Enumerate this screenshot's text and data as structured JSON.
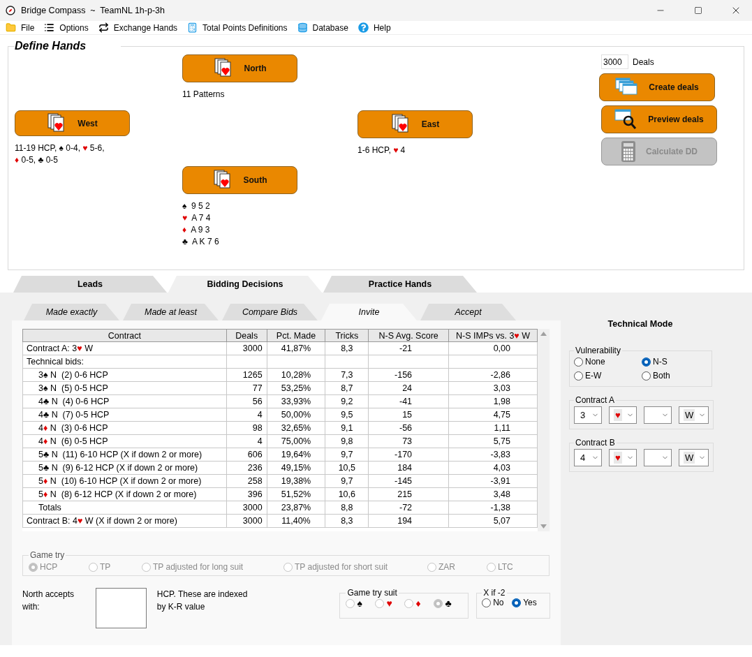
{
  "window": {
    "title": "Bridge Compass  ~  TeamNL 1h-p-3h"
  },
  "menu": [
    {
      "label": "File"
    },
    {
      "label": "Options"
    },
    {
      "label": "Exchange Hands"
    },
    {
      "label": "Total Points Definitions"
    },
    {
      "label": "Database"
    },
    {
      "label": "Help"
    }
  ],
  "define_hands": {
    "title": "Define Hands",
    "hands": [
      {
        "seat": "North",
        "lines": [
          [
            "11 Patterns"
          ]
        ]
      },
      {
        "seat": "West",
        "lines": [
          [
            "11-19 HCP, ",
            {
              "suit": "♠",
              "red": false
            },
            " 0-4, ",
            {
              "suit": "♥",
              "red": true
            },
            " 5-6,"
          ],
          [
            {
              "suit": "♦",
              "red": true
            },
            " 0-5, ",
            {
              "suit": "♣",
              "red": false
            },
            " 0-5"
          ]
        ]
      },
      {
        "seat": "East",
        "lines": [
          [
            "1-6 HCP, ",
            {
              "suit": "♥",
              "red": true
            },
            " 4"
          ]
        ]
      },
      {
        "seat": "South",
        "lines": [
          [
            {
              "suit": "♠",
              "red": false
            },
            "  9 5 2"
          ],
          [
            {
              "suit": "♥",
              "red": true
            },
            "  A 7 4"
          ],
          [
            {
              "suit": "♦",
              "red": true
            },
            "  A 9 3"
          ],
          [
            {
              "suit": "♣",
              "red": false
            },
            "  A K 7 6"
          ]
        ]
      }
    ],
    "deals": {
      "value": "3000",
      "label": "Deals"
    },
    "actions": [
      {
        "label": "Create deals",
        "disabled": false
      },
      {
        "label": "Preview deals",
        "disabled": false
      },
      {
        "label": "Calculate DD",
        "disabled": true
      }
    ]
  },
  "tabs": [
    {
      "label": "Leads",
      "selected": false
    },
    {
      "label": "Bidding Decisions",
      "selected": true
    },
    {
      "label": "Practice Hands",
      "selected": false
    }
  ],
  "subtabs": [
    {
      "label": "Made exactly",
      "selected": false
    },
    {
      "label": "Made at least",
      "selected": false
    },
    {
      "label": "Compare Bids",
      "selected": false
    },
    {
      "label": "Invite",
      "selected": true
    },
    {
      "label": "Accept",
      "selected": false
    }
  ],
  "table": {
    "columns": [
      [
        "Contract"
      ],
      [
        "Deals"
      ],
      [
        "Pct. Made"
      ],
      [
        "Tricks"
      ],
      [
        "N-S Avg. Score"
      ],
      [
        "N-S IMPs vs. 3",
        {
          "suit": "♥",
          "red": true
        },
        " W"
      ]
    ],
    "rows": [
      {
        "contract": [
          "Contract A: 3",
          {
            "suit": "♥",
            "red": true
          },
          " W"
        ],
        "deals": "3000",
        "pct": "41,87%",
        "tricks": "8,3",
        "avg": "-21",
        "imps": "0,00"
      },
      {
        "contract": [
          "Technical bids:"
        ],
        "children": [
          {
            "contract": [
              "3",
              {
                "suit": "♠",
                "red": false
              },
              " N  (2) 0-6 HCP"
            ],
            "deals": "1265",
            "pct": "10,28%",
            "tricks": "7,3",
            "avg": "-156",
            "imps": "-2,86"
          },
          {
            "contract": [
              "3",
              {
                "suit": "♠",
                "red": false
              },
              " N  (5) 0-5 HCP"
            ],
            "deals": "77",
            "pct": "53,25%",
            "tricks": "8,7",
            "avg": "24",
            "imps": "3,03"
          },
          {
            "contract": [
              "4",
              {
                "suit": "♣",
                "red": false
              },
              " N  (4) 0-6 HCP"
            ],
            "deals": "56",
            "pct": "33,93%",
            "tricks": "9,2",
            "avg": "-41",
            "imps": "1,98"
          },
          {
            "contract": [
              "4",
              {
                "suit": "♣",
                "red": false
              },
              " N  (7) 0-5 HCP"
            ],
            "deals": "4",
            "pct": "50,00%",
            "tricks": "9,5",
            "avg": "15",
            "imps": "4,75"
          },
          {
            "contract": [
              "4",
              {
                "suit": "♦",
                "red": true
              },
              " N  (3) 0-6 HCP"
            ],
            "deals": "98",
            "pct": "32,65%",
            "tricks": "9,1",
            "avg": "-56",
            "imps": "1,11"
          },
          {
            "contract": [
              "4",
              {
                "suit": "♦",
                "red": true
              },
              " N  (6) 0-5 HCP"
            ],
            "deals": "4",
            "pct": "75,00%",
            "tricks": "9,8",
            "avg": "73",
            "imps": "5,75"
          },
          {
            "contract": [
              "5",
              {
                "suit": "♣",
                "red": false
              },
              " N  (11) 6-10 HCP (X if down 2 or more)"
            ],
            "deals": "606",
            "pct": "19,64%",
            "tricks": "9,7",
            "avg": "-170",
            "imps": "-3,83"
          },
          {
            "contract": [
              "5",
              {
                "suit": "♣",
                "red": false
              },
              " N  (9) 6-12 HCP (X if down 2 or more)"
            ],
            "deals": "236",
            "pct": "49,15%",
            "tricks": "10,5",
            "avg": "184",
            "imps": "4,03"
          },
          {
            "contract": [
              "5",
              {
                "suit": "♦",
                "red": true
              },
              " N  (10) 6-10 HCP (X if down 2 or more)"
            ],
            "deals": "258",
            "pct": "19,38%",
            "tricks": "9,7",
            "avg": "-145",
            "imps": "-3,91"
          },
          {
            "contract": [
              "5",
              {
                "suit": "♦",
                "red": true
              },
              " N  (8) 6-12 HCP (X if down 2 or more)"
            ],
            "deals": "396",
            "pct": "51,52%",
            "tricks": "10,6",
            "avg": "215",
            "imps": "3,48"
          },
          {
            "contract": [
              "Totals"
            ],
            "deals": "3000",
            "pct": "23,87%",
            "tricks": "8,8",
            "avg": "-72",
            "imps": "-1,38"
          }
        ]
      },
      {
        "contract": [
          "Contract B: 4",
          {
            "suit": "♥",
            "red": true
          },
          " W (X if down 2 or more)"
        ],
        "deals": "3000",
        "pct": "11,40%",
        "tricks": "8,3",
        "avg": "194",
        "imps": "5,07"
      }
    ]
  },
  "game_try": {
    "title": "Game try",
    "disabled": true,
    "options": [
      {
        "label": "HCP",
        "selected": true
      },
      {
        "label": "TP",
        "selected": false
      },
      {
        "label": "TP adjusted for long suit",
        "selected": false
      },
      {
        "label": "TP adjusted for short suit",
        "selected": false
      },
      {
        "label": "ZAR",
        "selected": false
      },
      {
        "label": "LTC",
        "selected": false
      }
    ]
  },
  "accept": {
    "label": "North accepts with:",
    "note": "HCP. These are indexed by K-R value"
  },
  "game_try_suit": {
    "title": "Game try suit",
    "disabled": true,
    "options": [
      {
        "suit": "♠",
        "red": false,
        "selected": false
      },
      {
        "suit": "♥",
        "red": true,
        "selected": false
      },
      {
        "suit": "♦",
        "red": true,
        "selected": false
      },
      {
        "suit": "♣",
        "red": false,
        "selected": true
      }
    ]
  },
  "x_if_down": {
    "title": "X if -2",
    "disabled": false,
    "options": [
      {
        "label": "No",
        "selected": false
      },
      {
        "label": "Yes",
        "selected": true
      }
    ]
  },
  "technical": {
    "title": "Technical Mode",
    "vulnerability": {
      "title": "Vulnerability",
      "options": [
        {
          "label": "None",
          "selected": false
        },
        {
          "label": "N-S",
          "selected": true
        },
        {
          "label": "E-W",
          "selected": false
        },
        {
          "label": "Both",
          "selected": false
        }
      ]
    },
    "contracts": [
      {
        "title": "Contract A",
        "level": "3",
        "suit": {
          "suit": "♥",
          "red": true
        },
        "declarer": "W"
      },
      {
        "title": "Contract B",
        "level": "4",
        "suit": {
          "suit": "♥",
          "red": true
        },
        "declarer": "W"
      }
    ]
  }
}
